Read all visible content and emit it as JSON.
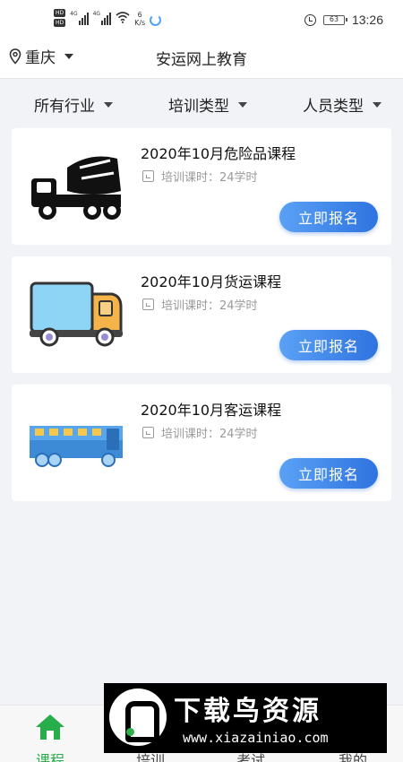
{
  "status_bar": {
    "hd": "HD",
    "network": "4G",
    "speed_value": "6",
    "speed_unit": "K/s",
    "battery": "63",
    "time": "13:26"
  },
  "header": {
    "city": "重庆",
    "title": "安运网上教育"
  },
  "filters": [
    {
      "label": "所有行业"
    },
    {
      "label": "培训类型"
    },
    {
      "label": "人员类型"
    }
  ],
  "courses": [
    {
      "title": "2020年10月危险品课程",
      "hours": "培训课时：24学时",
      "button": "立即报名",
      "image": "mixer-truck-icon"
    },
    {
      "title": "2020年10月货运课程",
      "hours": "培训课时：24学时",
      "button": "立即报名",
      "image": "cargo-truck-icon"
    },
    {
      "title": "2020年10月客运课程",
      "hours": "培训课时：24学时",
      "button": "立即报名",
      "image": "bus-icon"
    }
  ],
  "bottom_nav": [
    {
      "label": "课程",
      "active": true
    },
    {
      "label": "培训",
      "active": false
    },
    {
      "label": "考试",
      "active": false
    },
    {
      "label": "我的",
      "active": false
    }
  ],
  "watermark": {
    "text": "下载鸟资源",
    "url": "www.xiazainiao.com"
  },
  "colors": {
    "accent": "#2f73e0",
    "active_nav": "#27ae4a",
    "background": "#f2f3f7"
  }
}
